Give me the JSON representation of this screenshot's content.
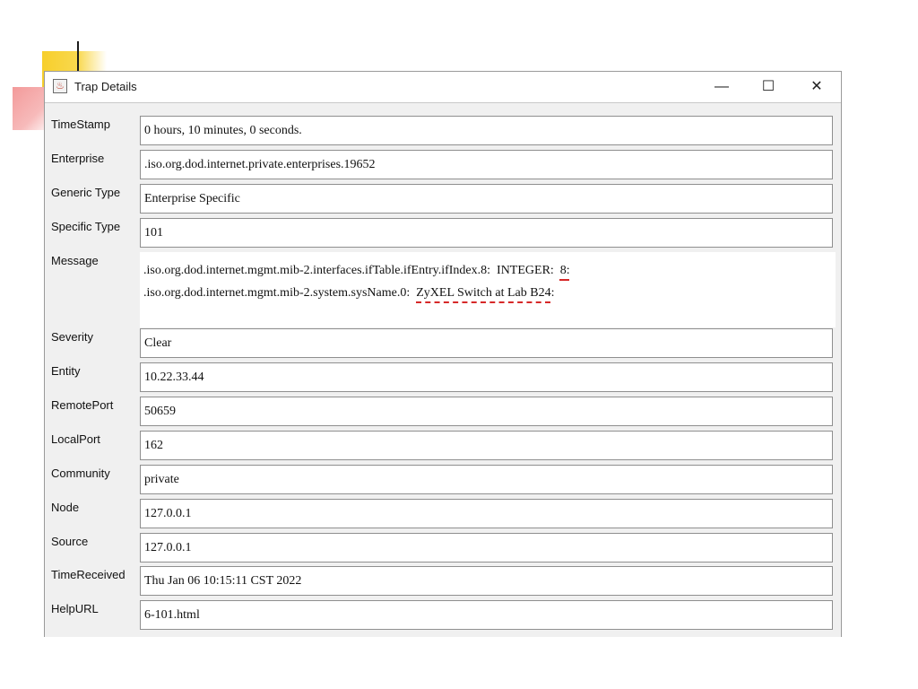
{
  "window": {
    "title": "Trap Details",
    "minimize_glyph": "—",
    "maximize_glyph": "☐",
    "close_glyph": "✕",
    "icon": "java-cup-icon"
  },
  "fields": {
    "timestamp": {
      "label": "TimeStamp",
      "value": "0 hours, 10 minutes, 0 seconds."
    },
    "enterprise": {
      "label": "Enterprise",
      "value": ".iso.org.dod.internet.private.enterprises.19652"
    },
    "generic_type": {
      "label": "Generic Type",
      "value": "Enterprise Specific"
    },
    "specific_type": {
      "label": "Specific Type",
      "value": "101"
    },
    "message": {
      "label": "Message",
      "line1_prefix": ".iso.org.dod.internet.mgmt.mib-2.interfaces.ifTable.ifEntry.ifIndex.8:  INTEGER:  ",
      "line1_highlight": "8:",
      "line2_prefix": ".iso.org.dod.internet.mgmt.mib-2.system.sysName.0:  ",
      "line2_highlight": "ZyXEL Switch at Lab B24",
      "line2_suffix": ":"
    },
    "severity": {
      "label": "Severity",
      "value": "Clear"
    },
    "entity": {
      "label": "Entity",
      "value": "10.22.33.44"
    },
    "remote_port": {
      "label": "RemotePort",
      "value": "50659"
    },
    "local_port": {
      "label": "LocalPort",
      "value": "162"
    },
    "community": {
      "label": "Community",
      "value": "private"
    },
    "node": {
      "label": "Node",
      "value": "127.0.0.1"
    },
    "source": {
      "label": "Source",
      "value": "127.0.0.1"
    },
    "time_received": {
      "label": "TimeReceived",
      "value": "Thu Jan 06 10:15:11 CST 2022"
    },
    "help_url": {
      "label": "HelpURL",
      "value": "6-101.html"
    }
  },
  "colors": {
    "accent_yellow": "#f7cf2b",
    "accent_red": "#f39a9a",
    "highlight_underline": "#d62828"
  }
}
